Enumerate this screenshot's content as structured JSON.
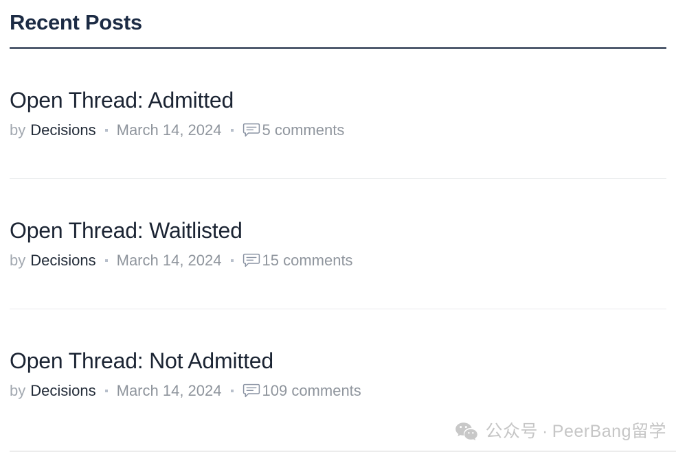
{
  "widget": {
    "title": "Recent Posts"
  },
  "posts": [
    {
      "title": "Open Thread: Admitted",
      "by_label": "by",
      "author": "Decisions",
      "date": "March 14, 2024",
      "comments": "5 comments",
      "comment_icon": "comment-bubble-icon"
    },
    {
      "title": "Open Thread: Waitlisted",
      "by_label": "by",
      "author": "Decisions",
      "date": "March 14, 2024",
      "comments": "15 comments",
      "comment_icon": "comment-bubble-icon"
    },
    {
      "title": "Open Thread: Not Admitted",
      "by_label": "by",
      "author": "Decisions",
      "date": "March 14, 2024",
      "comments": "109 comments",
      "comment_icon": "comment-bubble-icon"
    }
  ],
  "watermark": {
    "icon": "wechat-icon",
    "label": "公众号",
    "separator": "·",
    "name": "PeerBang留学"
  },
  "colors": {
    "heading": "#1c2b44",
    "post_title": "#1b2433",
    "author": "#222b38",
    "meta_muted": "#8f959d",
    "divider": "#e8eaec",
    "watermark": "#c6c6c6",
    "background": "#ffffff"
  }
}
